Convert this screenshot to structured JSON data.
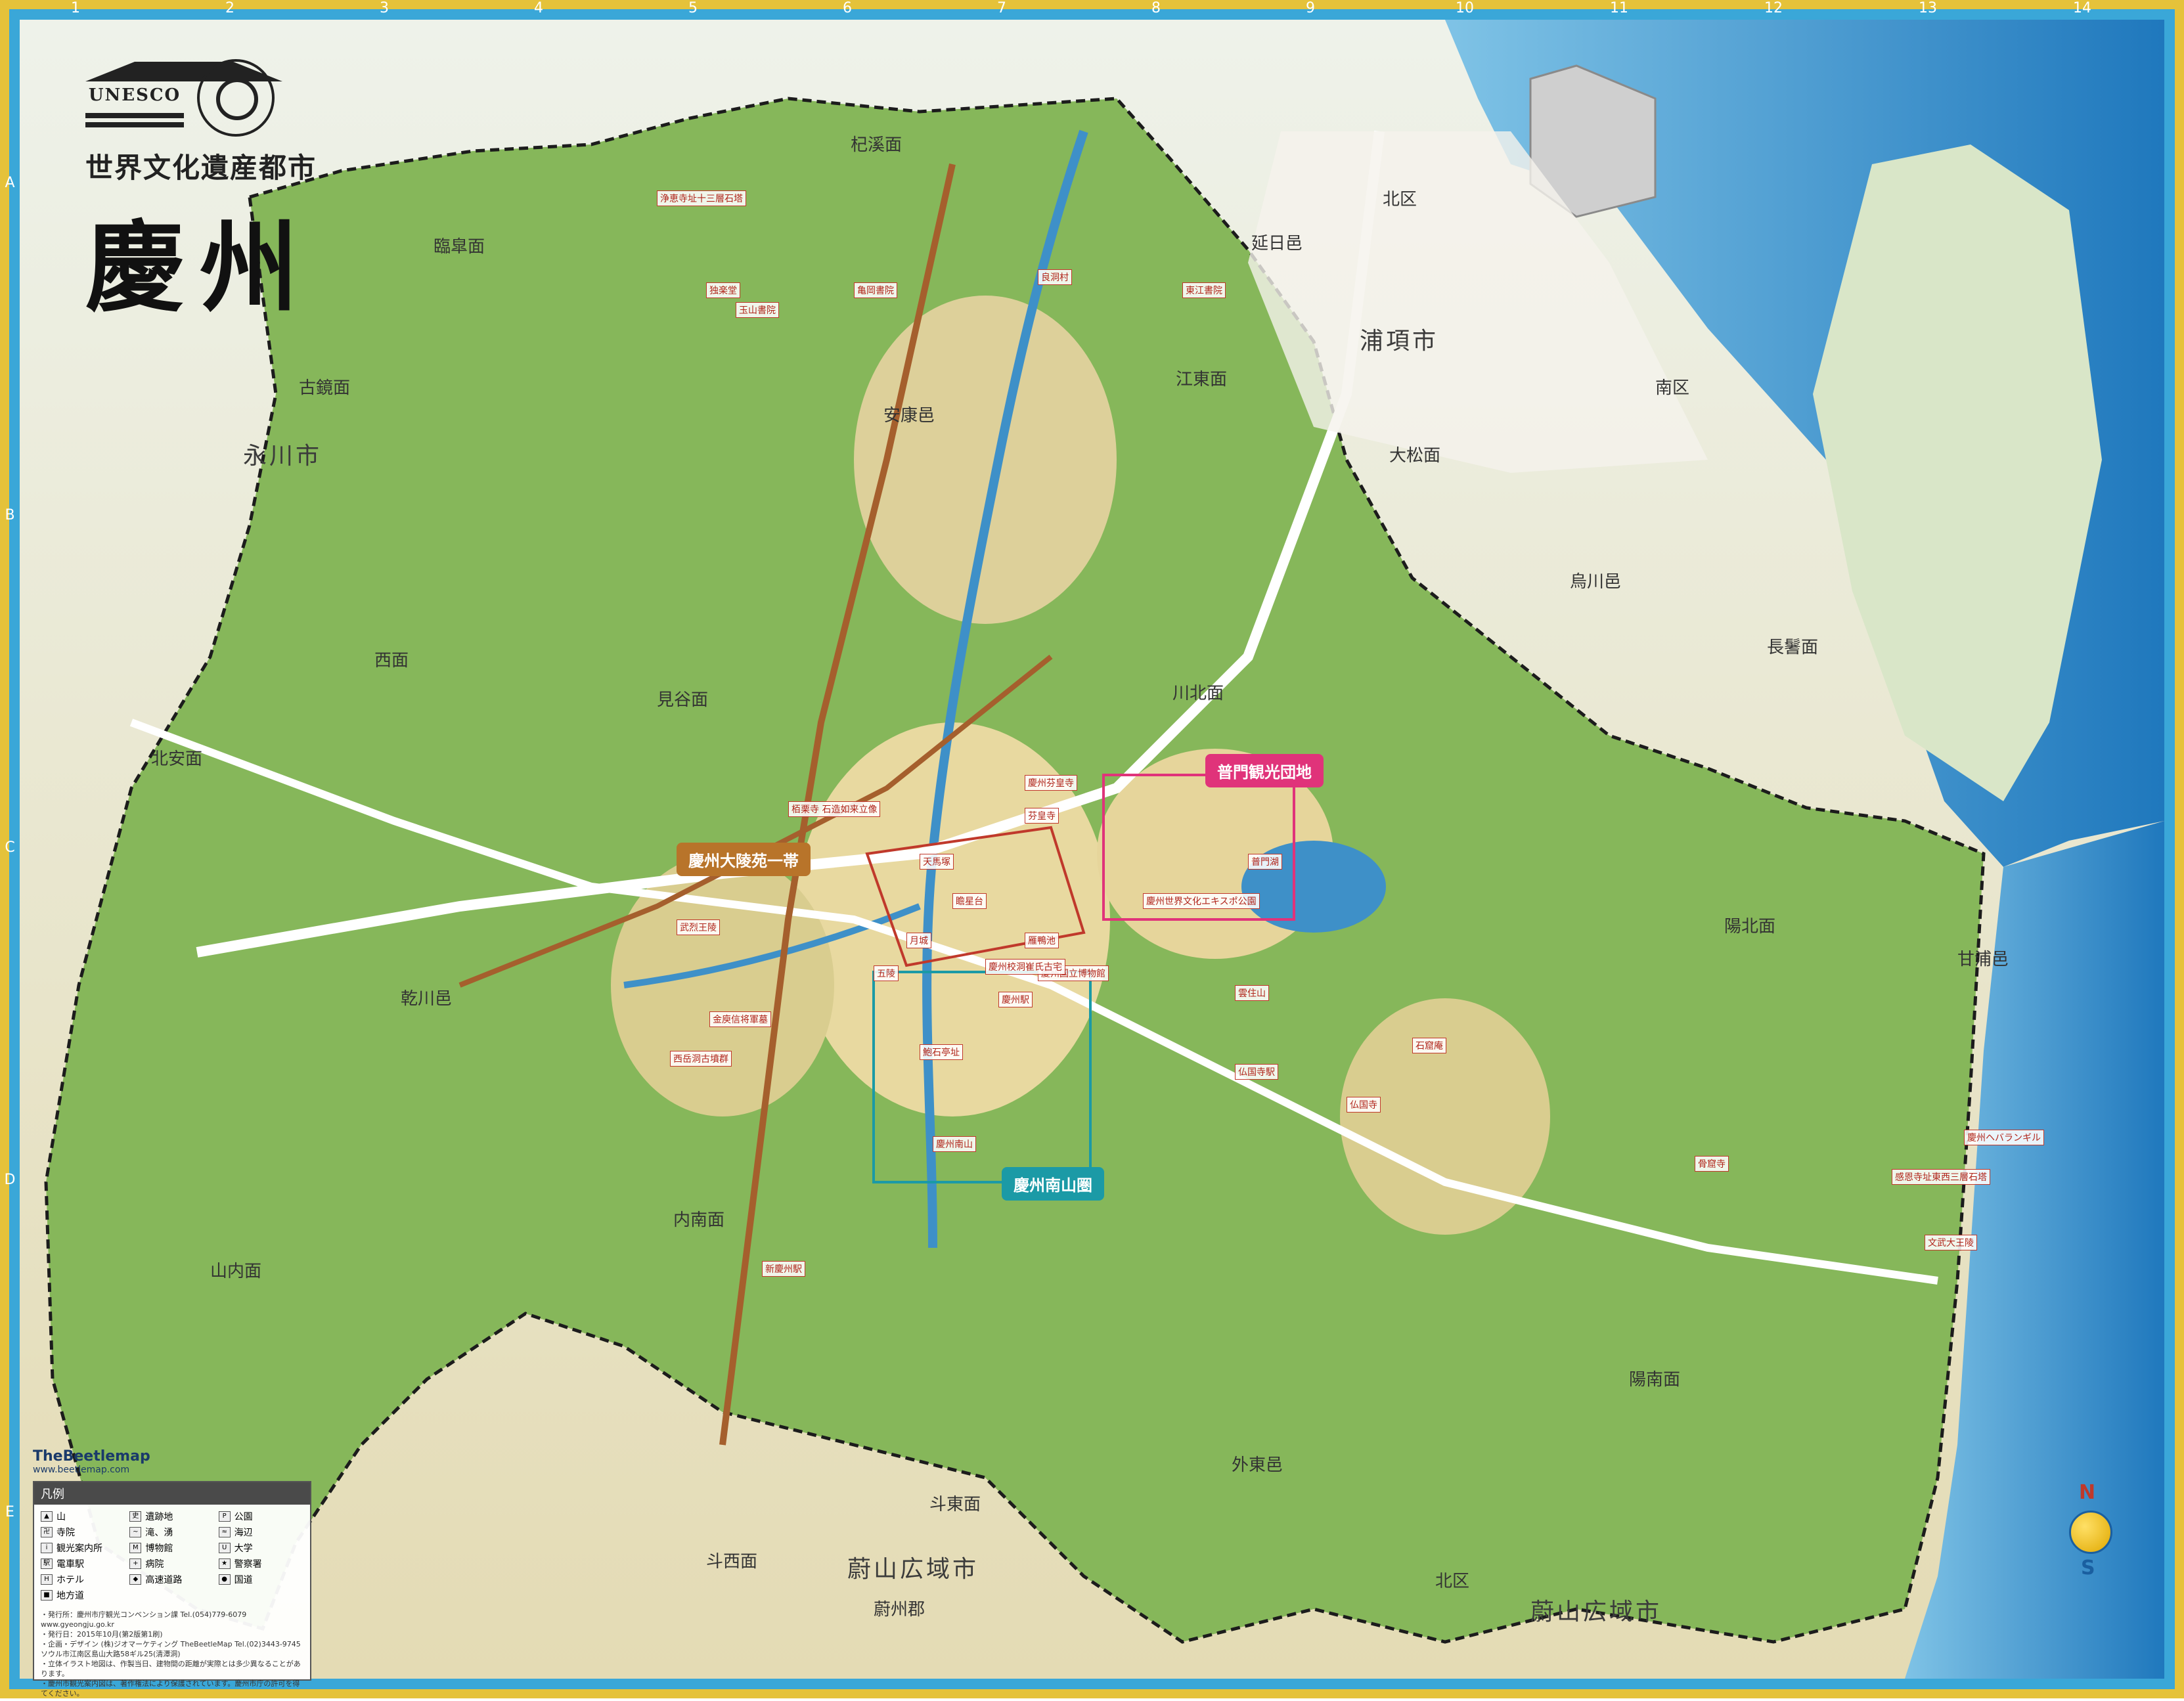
{
  "header": {
    "logo_text": "UNESCO",
    "subtitle": "世界文化遺産都市",
    "title": "慶州"
  },
  "grid": {
    "columns": [
      "1",
      "2",
      "3",
      "4",
      "5",
      "6",
      "7",
      "8",
      "9",
      "10",
      "11",
      "12",
      "13",
      "14"
    ],
    "rows": [
      "A",
      "B",
      "C",
      "D",
      "E"
    ]
  },
  "regions": {
    "cities": [
      "浦項市",
      "永川市",
      "蔚山広域市",
      "蔚山広域市"
    ],
    "districts": [
      "臨皐面",
      "古鏡面",
      "北安面",
      "西面",
      "乾川邑",
      "山内面",
      "見谷面",
      "内南面",
      "杞溪面",
      "安康邑",
      "江東面",
      "川北面",
      "延日邑",
      "北区",
      "南区",
      "大松面",
      "烏川邑",
      "長鬐面",
      "陽北面",
      "甘浦邑",
      "陽南面",
      "外東邑",
      "斗東面",
      "斗西面",
      "北区",
      "蔚州郡"
    ]
  },
  "badges": {
    "bomun": "普門観光団地",
    "daereungwon": "慶州大陵苑一帯",
    "namsan": "慶州南山圏"
  },
  "sites": [
    "浄恵寺址十三層石塔",
    "独楽堂",
    "玉山書院",
    "亀岡書院",
    "良洞村",
    "東江書院",
    "栢栗寺 石造如来立像",
    "慶州芬皇寺",
    "瞻星台",
    "月城",
    "雁鴨池",
    "仏国寺",
    "石窟庵",
    "感恩寺址東西三層石塔",
    "文武大王陵",
    "骨窟寺",
    "慶州南山",
    "鮑石亭址",
    "西岳洞古墳群",
    "金庾信将軍墓",
    "武烈王陵",
    "五陵",
    "天馬塚",
    "慶州国立博物館",
    "普門湖",
    "慶州世界文化エキスポ公園",
    "慶州ヘバランギル",
    "雲住山",
    "仏国寺駅",
    "新慶州駅",
    "慶州駅",
    "芬皇寺",
    "慶州校洞崔氏古宅"
  ],
  "legend": {
    "title": "凡例",
    "items": [
      "山",
      "遺跡地",
      "公園",
      "寺院",
      "滝、湧",
      "海辺",
      "観光案内所",
      "博物館",
      "大学",
      "電車駅",
      "病院",
      "警察署",
      "ホテル",
      "高速道路",
      "国道",
      "地方道"
    ],
    "notes": [
      "・発行所：慶州市庁観光コンベンション課 Tel.(054)779-6079 www.gyeongju.go.kr",
      "・発行日：2015年10月(第2版第1刷)",
      "・企画・デザイン (株)ジオマーケティング TheBeetleMap Tel.(02)3443-9745",
      "ソウル市江南区島山大路58ギル25(清潭洞)",
      "・立体イラスト地図は、作製当日、建物間の距離が実際とは多少異なることがあります。",
      "・慶州市観光案内図は、著作権法により保護されています。慶州市庁の許可を得てください。"
    ],
    "brand": "TheBeetlemap",
    "brand_url": "www.beetlemap.com"
  },
  "compass": {
    "north": "N",
    "south": "S"
  },
  "colors": {
    "frame": "#3aa7d8",
    "gold": "#e5c23a",
    "sea": "#2f8fcf",
    "land": "#e9dfb2",
    "forest": "#6fa84a",
    "boundary": "#222222",
    "bomun_badge": "#e0337a",
    "daereungwon_badge": "#b8742a",
    "namsan_badge": "#1b9aa6"
  }
}
